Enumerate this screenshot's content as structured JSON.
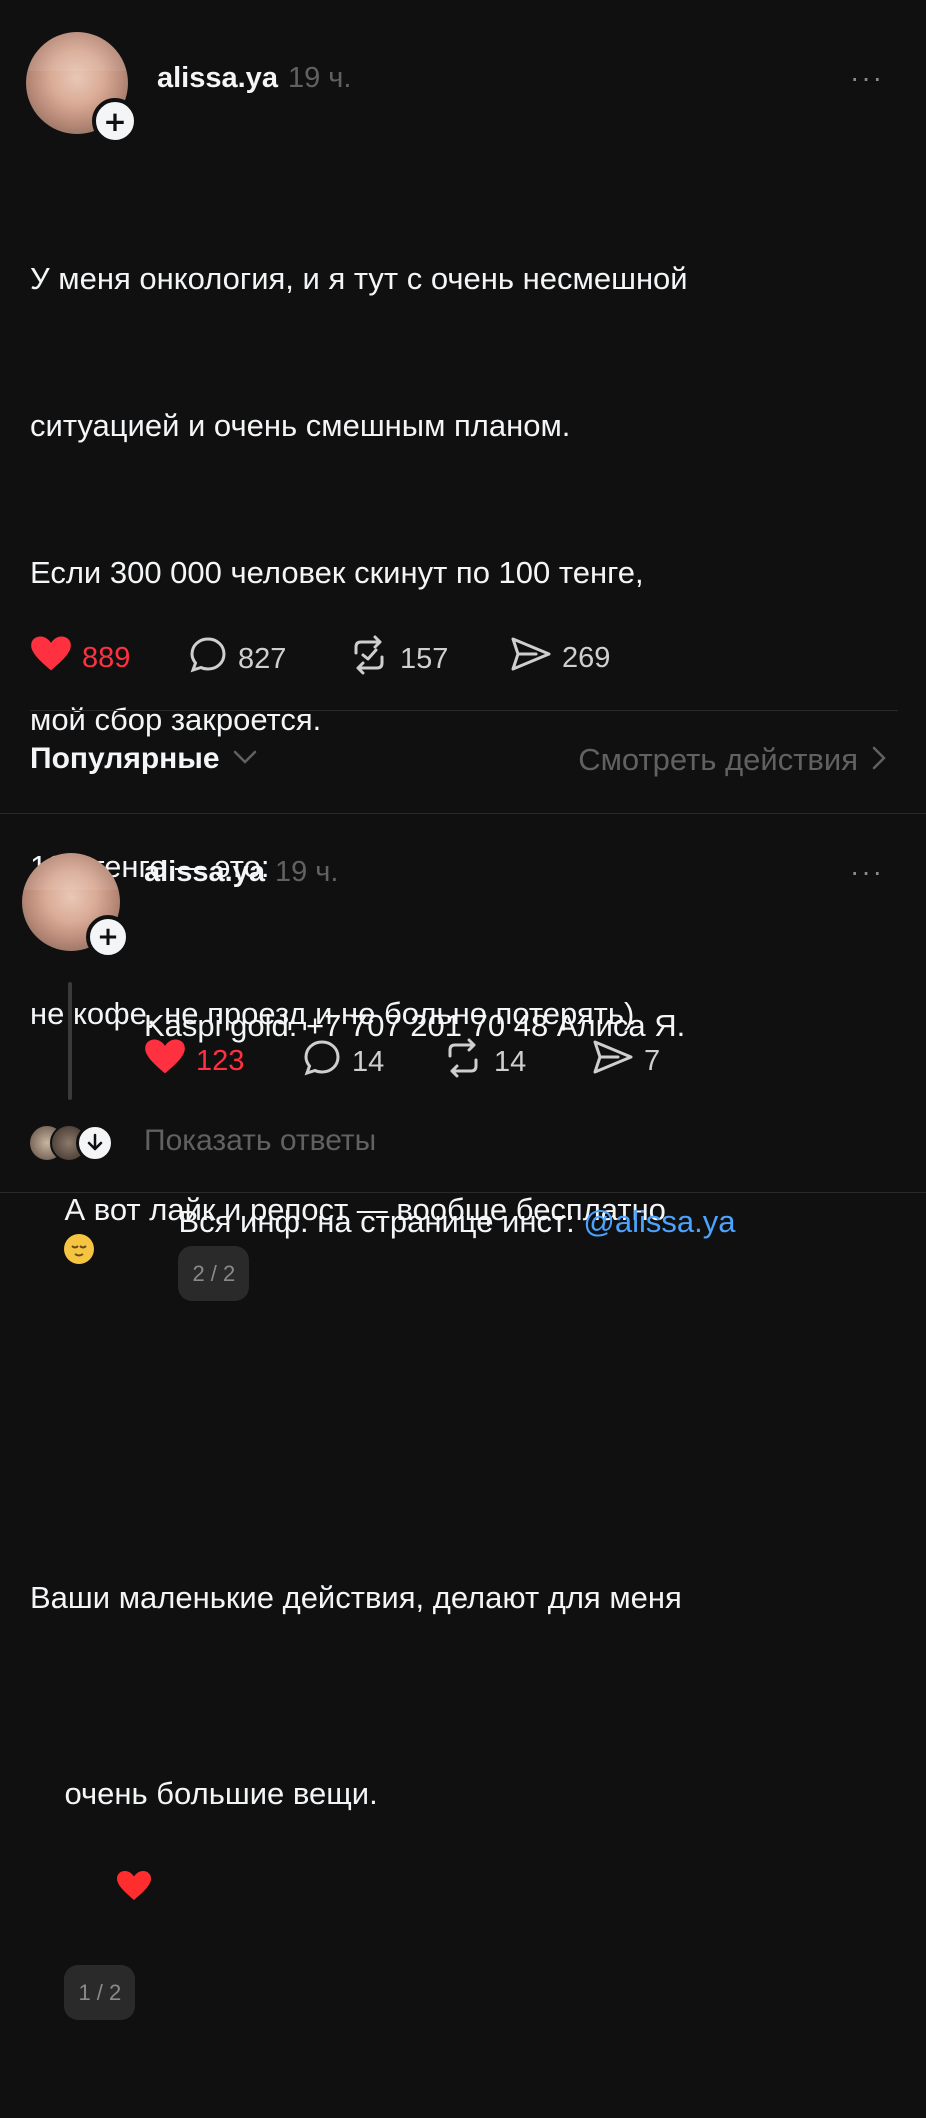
{
  "post": {
    "username": "alissa.ya",
    "time": "19 ч.",
    "more": "···",
    "lines": [
      "У меня онкология, и я тут с очень несмешной",
      "ситуацией и очень смешным планом.",
      "Если 300 000 человек скинут по 100 тенге,",
      "мой сбор закроется.",
      "100 тенге — это:",
      "не кофе, не проезд и не больно потерять)",
      "А вот лайк и репост — вообще бесплатно",
      "Ваши маленькие действия, делают для меня",
      "очень большие вещи."
    ],
    "pager": "1 / 2",
    "likes": "889",
    "comments": "827",
    "reposts": "157",
    "shares": "269"
  },
  "sort": {
    "label": "Популярные",
    "activity": "Смотреть действия"
  },
  "reply": {
    "username": "alissa.ya",
    "time": "19 ч.",
    "more": "···",
    "line1": "Kaspi gold: +7 707 201 70 48 Алиса Я.",
    "line2_prefix": "Вся инф. на странице инст: ",
    "mention": "@alissa.ya",
    "pager": "2 / 2",
    "likes": "123",
    "comments": "14",
    "reposts": "14",
    "shares": "7"
  },
  "show_replies": "Показать ответы",
  "colors": {
    "background": "#101010",
    "like_red": "#ff3040",
    "mention_blue": "#4ba3ff",
    "muted": "#616161"
  }
}
